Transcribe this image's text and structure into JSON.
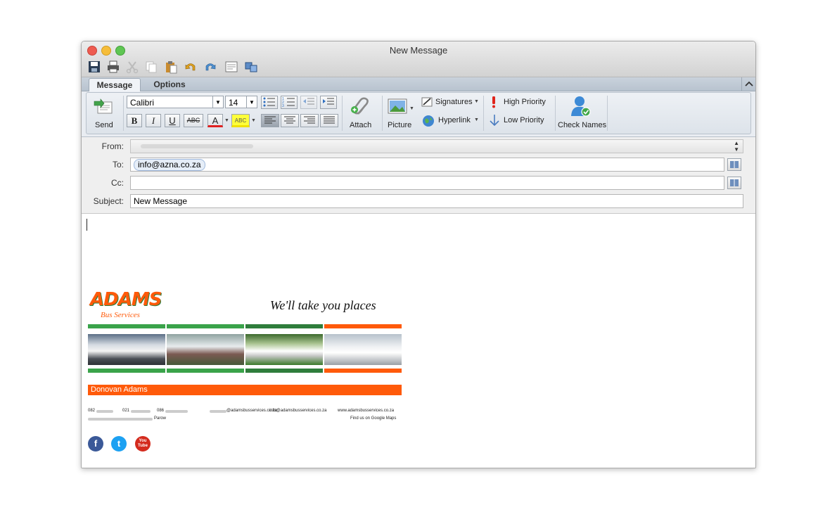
{
  "window": {
    "title": "New Message"
  },
  "tabs": {
    "message": "Message",
    "options": "Options"
  },
  "ribbon": {
    "send": "Send",
    "font_name": "Calibri",
    "font_size": "14",
    "bold": "B",
    "italic": "I",
    "underline": "U",
    "strike": "ABC",
    "font_color": "A",
    "highlight": "ABC",
    "attach": "Attach",
    "picture": "Picture",
    "signatures": "Signatures",
    "hyperlink": "Hyperlink",
    "high_priority": "High Priority",
    "low_priority": "Low Priority",
    "check_names": "Check Names"
  },
  "headers": {
    "from_label": "From:",
    "from_value": "",
    "to_label": "To:",
    "to_recipient": "info@azna.co.za",
    "cc_label": "Cc:",
    "cc_value": "",
    "subject_label": "Subject:",
    "subject_value": "New Message"
  },
  "signature": {
    "logo_text": "ADAMS",
    "logo_sub": "Bus Services",
    "tagline": "We'll take you places",
    "name": "Donovan Adams",
    "phone1_prefix": "082",
    "phone2_prefix": "021",
    "phone3_prefix": "086",
    "email1": "@adamsbusservices.co.za",
    "email2": "info@adamsbusservices.co.za",
    "website": "www.adamsbusservices.co.za",
    "city": "Parow",
    "maps": "Find us on Google Maps",
    "social": {
      "facebook": "f",
      "twitter": "t",
      "youtube": "You Tube"
    }
  },
  "colors": {
    "green": "#3aa34a",
    "dark_green": "#2f7d3c",
    "orange": "#ff5a0a",
    "accent_blue": "#6f94c4"
  }
}
